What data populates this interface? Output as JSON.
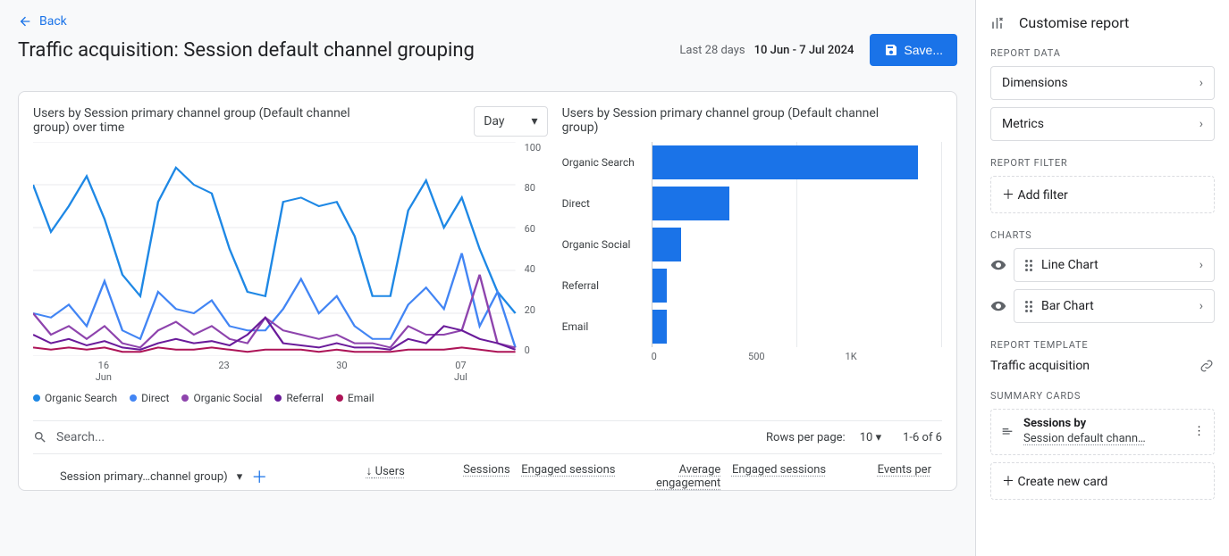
{
  "header": {
    "back_label": "Back",
    "page_title": "Traffic acquisition: Session default channel grouping",
    "date_light": "Last 28 days",
    "date_bold": "10 Jun - 7 Jul 2024",
    "save_label": "Save..."
  },
  "line_panel": {
    "title": "Users by Session primary channel group (Default channel group) over time",
    "granularity": "Day",
    "y_ticks": [
      "100",
      "80",
      "60",
      "40",
      "20",
      "0"
    ],
    "x_ticks": [
      {
        "top": "16",
        "bottom": "Jun"
      },
      {
        "top": "23",
        "bottom": ""
      },
      {
        "top": "30",
        "bottom": ""
      },
      {
        "top": "07",
        "bottom": "Jul"
      }
    ],
    "legend": [
      {
        "name": "Organic Search",
        "color": "#1e88e5"
      },
      {
        "name": "Direct",
        "color": "#4285f4"
      },
      {
        "name": "Organic Social",
        "color": "#8e44ad"
      },
      {
        "name": "Referral",
        "color": "#6a1b9a"
      },
      {
        "name": "Email",
        "color": "#ad1457"
      }
    ]
  },
  "bar_panel": {
    "title": "Users by Session primary channel group (Default channel group)",
    "x_ticks": [
      "0",
      "500",
      "1K"
    ]
  },
  "table": {
    "search_placeholder": "Search...",
    "rows_per_page_label": "Rows per page:",
    "rows_per_page_value": "10",
    "page_info": "1-6 of 6",
    "first_col": "Session primary…channel group)",
    "columns": [
      "Users",
      "Sessions",
      "Engaged sessions",
      "Average engagement",
      "Engaged sessions",
      "Events per"
    ]
  },
  "sidebar": {
    "title": "Customise report",
    "data_label": "REPORT DATA",
    "dimensions": "Dimensions",
    "metrics": "Metrics",
    "filter_label": "REPORT FILTER",
    "add_filter": "Add filter",
    "charts_label": "CHARTS",
    "line_chart": "Line Chart",
    "bar_chart": "Bar Chart",
    "template_label": "REPORT TEMPLATE",
    "template_name": "Traffic acquisition",
    "summary_label": "SUMMARY CARDS",
    "summary_title": "Sessions by",
    "summary_sub": "Session default chann…",
    "create_card": "Create new card"
  },
  "chart_data": [
    {
      "type": "line",
      "title": "Users by Session primary channel group (Default channel group) over time",
      "xlabel": "",
      "ylabel": "",
      "ylim": [
        0,
        100
      ],
      "x": [
        "10 Jun",
        "11",
        "12",
        "13",
        "14",
        "15",
        "16",
        "17",
        "18",
        "19",
        "20",
        "21",
        "22",
        "23",
        "24",
        "25",
        "26",
        "27",
        "28",
        "29",
        "30",
        "1 Jul",
        "2",
        "3",
        "4",
        "5",
        "6",
        "7"
      ],
      "series": [
        {
          "name": "Organic Search",
          "color": "#1e88e5",
          "values": [
            80,
            58,
            70,
            84,
            64,
            38,
            28,
            72,
            88,
            80,
            76,
            50,
            30,
            28,
            72,
            74,
            70,
            72,
            56,
            28,
            28,
            68,
            82,
            60,
            74,
            50,
            30,
            20
          ]
        },
        {
          "name": "Direct",
          "color": "#4285f4",
          "values": [
            20,
            18,
            24,
            14,
            35,
            12,
            8,
            30,
            22,
            20,
            26,
            14,
            12,
            12,
            22,
            36,
            20,
            28,
            14,
            8,
            8,
            24,
            32,
            22,
            48,
            14,
            30,
            4
          ]
        },
        {
          "name": "Organic Social",
          "color": "#8e44ad",
          "values": [
            20,
            10,
            14,
            8,
            14,
            6,
            4,
            12,
            16,
            10,
            14,
            8,
            6,
            18,
            12,
            10,
            8,
            10,
            6,
            6,
            4,
            14,
            10,
            10,
            12,
            38,
            6,
            4
          ]
        },
        {
          "name": "Referral",
          "color": "#6a1b9a",
          "values": [
            10,
            6,
            8,
            5,
            7,
            4,
            3,
            6,
            8,
            6,
            7,
            5,
            10,
            18,
            6,
            5,
            4,
            6,
            4,
            4,
            3,
            8,
            6,
            14,
            12,
            8,
            6,
            3
          ]
        },
        {
          "name": "Email",
          "color": "#ad1457",
          "values": [
            4,
            3,
            4,
            3,
            4,
            2,
            2,
            4,
            3,
            3,
            4,
            3,
            2,
            3,
            3,
            3,
            2,
            3,
            2,
            2,
            2,
            3,
            3,
            3,
            4,
            3,
            2,
            2
          ]
        }
      ]
    },
    {
      "type": "bar",
      "title": "Users by Session primary channel group (Default channel group)",
      "xlabel": "",
      "ylabel": "",
      "xlim": [
        0,
        1200
      ],
      "categories": [
        "Organic Search",
        "Direct",
        "Organic Social",
        "Referral",
        "Email"
      ],
      "values": [
        1100,
        320,
        120,
        60,
        60
      ]
    }
  ]
}
